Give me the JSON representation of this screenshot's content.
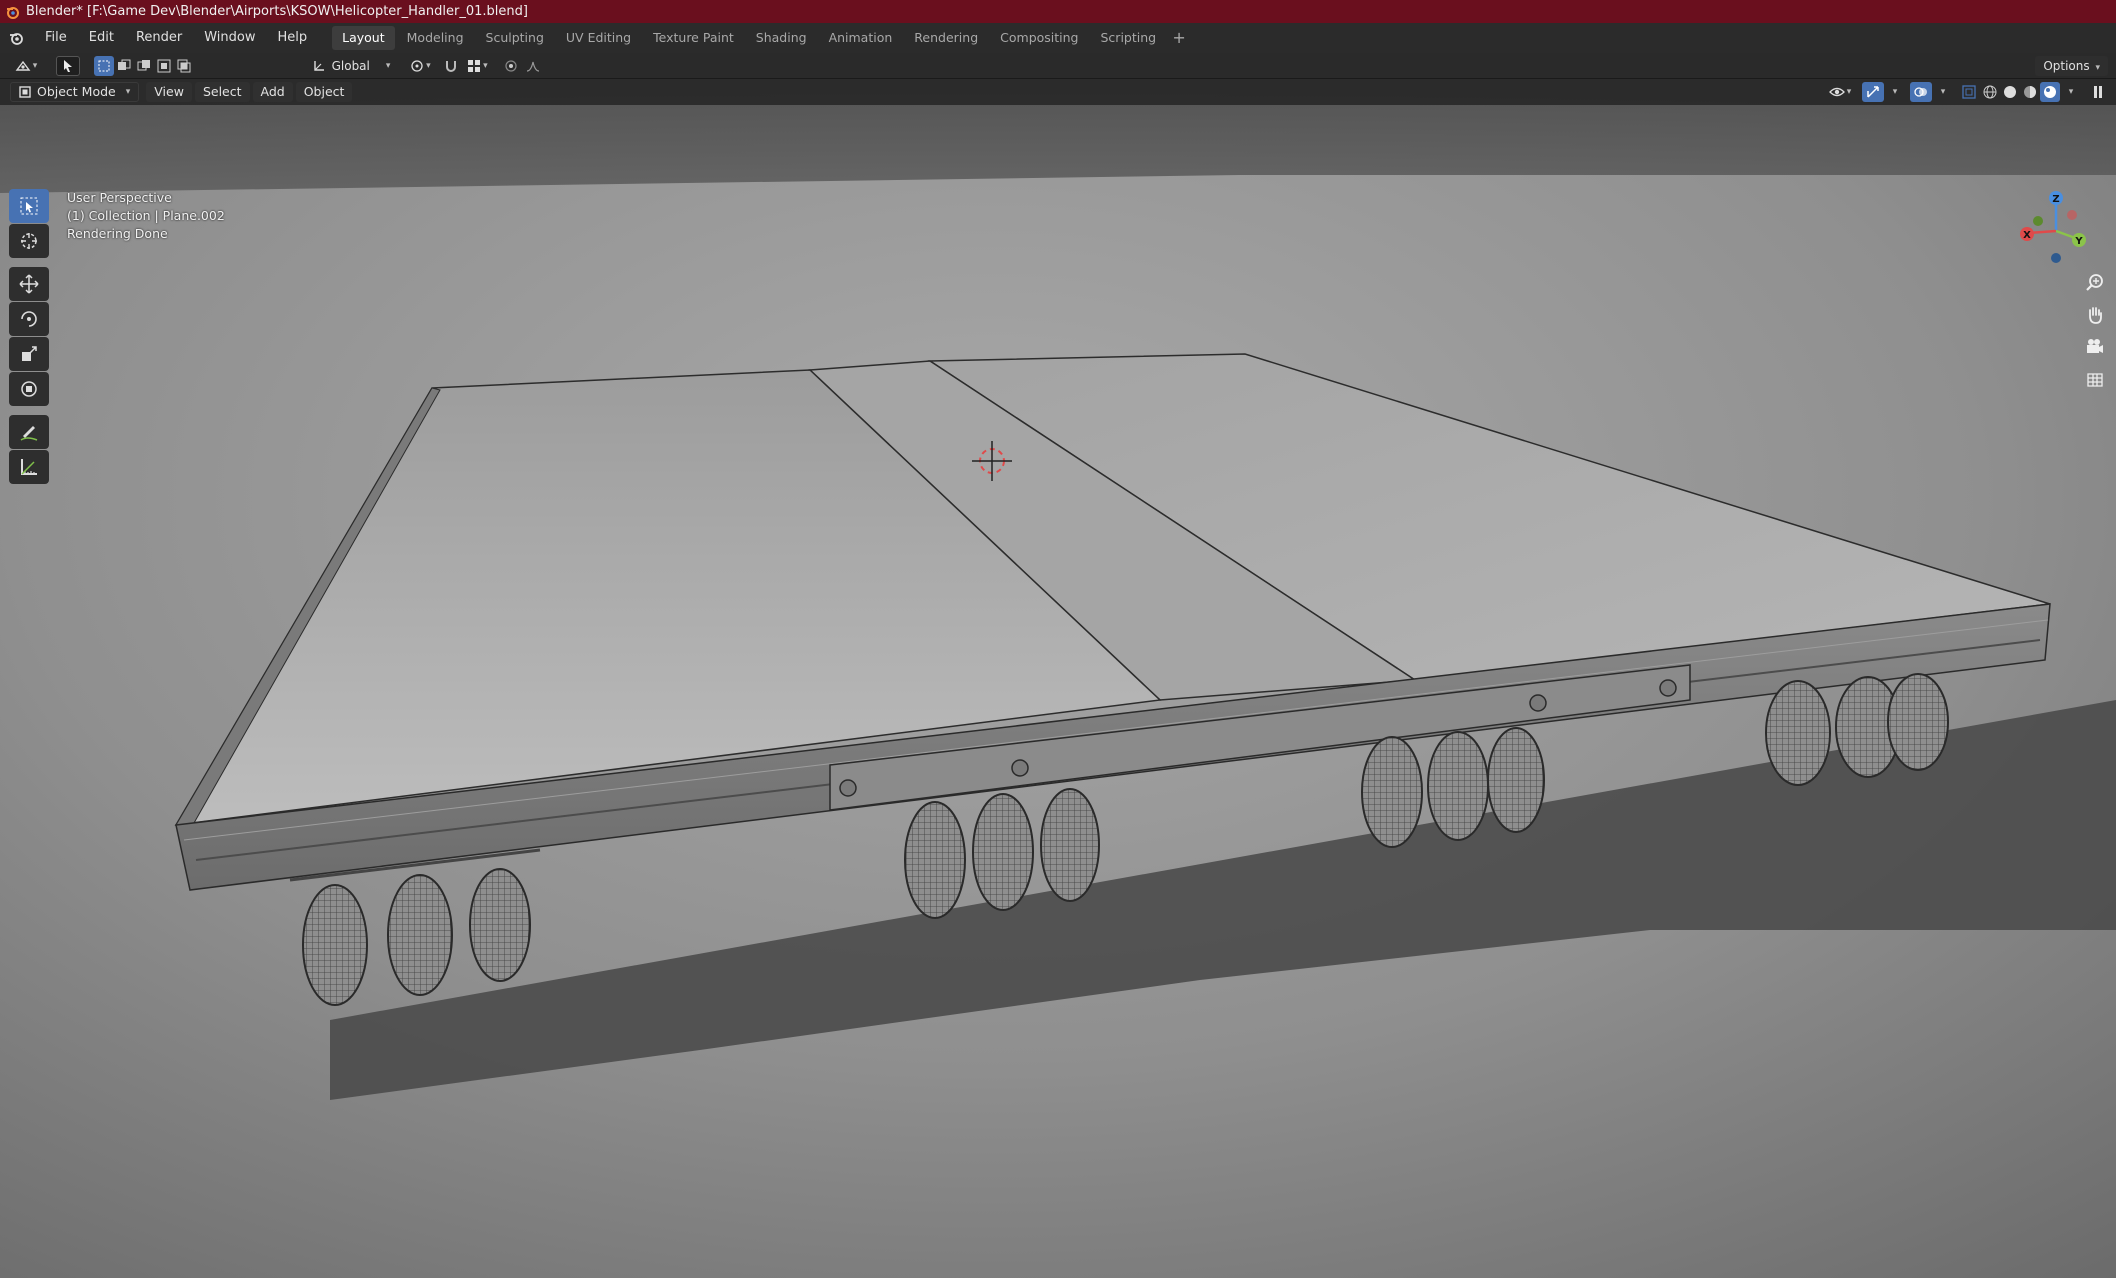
{
  "window": {
    "title": "Blender* [F:\\Game Dev\\Blender\\Airports\\KSOW\\Helicopter_Handler_01.blend]"
  },
  "menu": {
    "items": [
      "File",
      "Edit",
      "Render",
      "Window",
      "Help"
    ]
  },
  "workspaces": {
    "tabs": [
      "Layout",
      "Modeling",
      "Sculpting",
      "UV Editing",
      "Texture Paint",
      "Shading",
      "Animation",
      "Rendering",
      "Compositing",
      "Scripting"
    ],
    "active": "Layout",
    "add_label": "+"
  },
  "tool_header": {
    "transform_orientation": "Global",
    "options_label": "Options"
  },
  "viewport_header": {
    "mode": "Object Mode",
    "menus": [
      "View",
      "Select",
      "Add",
      "Object"
    ]
  },
  "viewport": {
    "perspective": "User Perspective",
    "collection": "(1) Collection | Plane.002",
    "status": "Rendering Done"
  },
  "gizmo": {
    "x_label": "X",
    "y_label": "Y",
    "z_label": "Z"
  },
  "colors": {
    "titlebar": "#6a0f1e",
    "accent": "#4772b3",
    "axis_x": "#e04a4a",
    "axis_y": "#8bc34a",
    "axis_z": "#4a8fe0"
  },
  "icons": {
    "toolbar": [
      "select-box-icon",
      "cursor-icon",
      "move-icon",
      "rotate-icon",
      "scale-icon",
      "transform-icon",
      "annotate-icon",
      "measure-icon"
    ],
    "nav": [
      "zoom-icon",
      "pan-hand-icon",
      "camera-icon",
      "grid-icon"
    ]
  }
}
